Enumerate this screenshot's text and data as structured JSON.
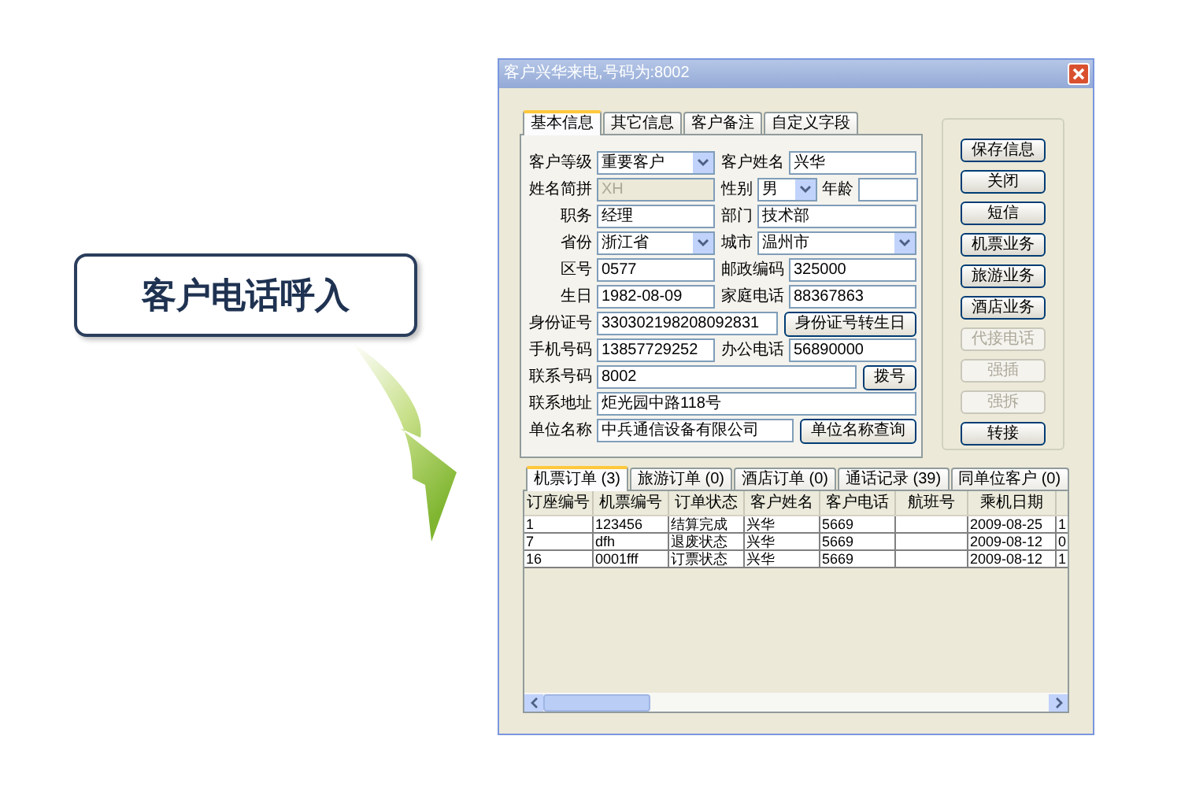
{
  "callout": {
    "text": "客户电话呼入"
  },
  "dialog": {
    "title": "客户兴华来电,号码为:8002",
    "tabs": [
      {
        "label": "基本信息",
        "selected": true
      },
      {
        "label": "其它信息",
        "selected": false
      },
      {
        "label": "客户备注",
        "selected": false
      },
      {
        "label": "自定义字段",
        "selected": false
      }
    ],
    "form_rows": [
      {
        "left": [
          {
            "kind": "select",
            "label": "客户等级",
            "value": "重要客户"
          }
        ],
        "right": [
          {
            "kind": "text",
            "label": "客户姓名",
            "value": "兴华"
          }
        ]
      },
      {
        "left": [
          {
            "kind": "text",
            "label": "姓名简拼",
            "value": "XH",
            "disabled": true
          }
        ],
        "right": [
          {
            "kind": "select",
            "label": "性别",
            "value": "男"
          },
          {
            "kind": "text",
            "label": "年龄"
          }
        ]
      },
      {
        "left": [
          {
            "kind": "text",
            "label": "职务",
            "value": "经理"
          }
        ],
        "right": [
          {
            "kind": "text",
            "label": "部门",
            "value": "技术部"
          }
        ]
      },
      {
        "left": [
          {
            "kind": "select",
            "label": "省份",
            "value": "浙江省"
          }
        ],
        "right": [
          {
            "kind": "select",
            "label": "城市",
            "value": "温州市"
          }
        ]
      },
      {
        "left": [
          {
            "kind": "text",
            "label": "区号",
            "value": "0577"
          }
        ],
        "right": [
          {
            "kind": "text",
            "label": "邮政编码",
            "value": "325000"
          }
        ]
      },
      {
        "left": [
          {
            "kind": "text",
            "label": "生日",
            "value": "1982-08-09"
          }
        ],
        "right": [
          {
            "kind": "text",
            "label": "家庭电话",
            "value": "88367863"
          }
        ]
      },
      {
        "left": [
          {
            "kind": "text",
            "label": "身份证号",
            "value": "330302198208092831"
          }
        ],
        "right": [
          {
            "kind": "button",
            "value": "身份证号转生日"
          }
        ]
      },
      {
        "left": [
          {
            "kind": "text",
            "label": "手机号码",
            "value": "13857729252"
          }
        ],
        "right": [
          {
            "kind": "text",
            "label": "办公电话",
            "value": "56890000"
          }
        ]
      },
      {
        "left": [
          {
            "kind": "text",
            "label": "联系号码",
            "value": "8002"
          }
        ],
        "right": [
          {
            "kind": "button",
            "value": "拨号"
          }
        ]
      },
      {
        "left": [
          {
            "kind": "text",
            "label": "联系地址",
            "value": "炬光园中路118号"
          }
        ]
      },
      {
        "left": [
          {
            "kind": "text",
            "label": "单位名称",
            "value": "中兵通信设备有限公司"
          }
        ],
        "right": [
          {
            "kind": "button",
            "value": "单位名称查询"
          }
        ]
      }
    ],
    "side_buttons": [
      {
        "label": "保存信息",
        "disabled": false
      },
      {
        "label": "关闭",
        "disabled": false
      },
      {
        "label": "短信",
        "disabled": false
      },
      {
        "label": "机票业务",
        "disabled": false
      },
      {
        "label": "旅游业务",
        "disabled": false
      },
      {
        "label": "酒店业务",
        "disabled": false
      },
      {
        "label": "代接电话",
        "disabled": true
      },
      {
        "label": "强插",
        "disabled": true
      },
      {
        "label": "强拆",
        "disabled": true
      },
      {
        "label": "转接",
        "disabled": false
      }
    ],
    "order_tabs": [
      {
        "label": "机票订单 (3)",
        "selected": true
      },
      {
        "label": "旅游订单 (0)",
        "selected": false
      },
      {
        "label": "酒店订单 (0)",
        "selected": false
      },
      {
        "label": "通话记录 (39)",
        "selected": false
      },
      {
        "label": "同单位客户 (0)",
        "selected": false
      }
    ],
    "table": {
      "columns": [
        "订座编号",
        "机票编号",
        "订单状态",
        "客户姓名",
        "客户电话",
        "航班号",
        "乘机日期"
      ],
      "rows": [
        [
          "1",
          "123456",
          "结算完成",
          "兴华",
          "5669",
          "",
          "2009-08-25",
          "1"
        ],
        [
          "7",
          "dfh",
          "退废状态",
          "兴华",
          "5669",
          "",
          "2009-08-12",
          "0"
        ],
        [
          "16",
          "0001fff",
          "订票状态",
          "兴华",
          "5669",
          "",
          "2009-08-12",
          "1"
        ]
      ]
    }
  }
}
